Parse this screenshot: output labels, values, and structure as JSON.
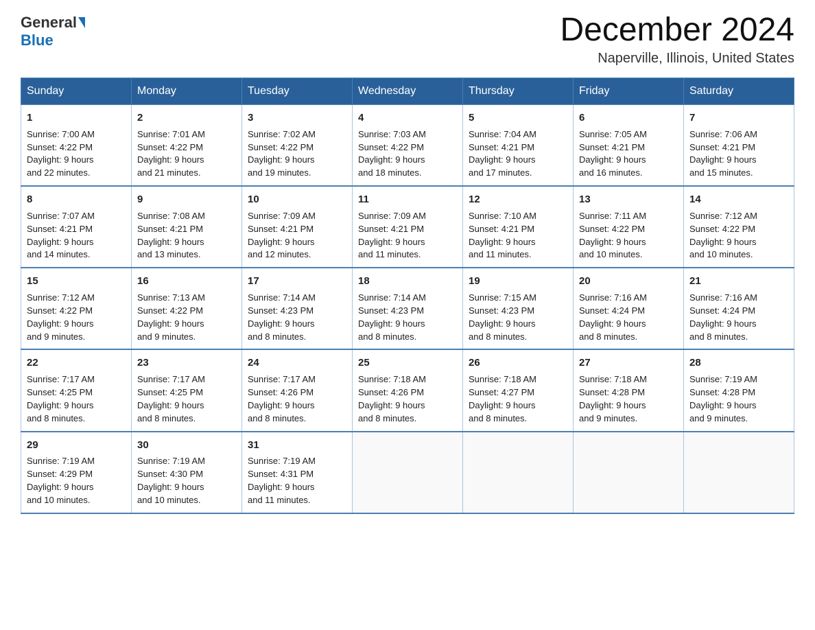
{
  "logo": {
    "text_general": "General",
    "text_blue": "Blue"
  },
  "title": "December 2024",
  "location": "Naperville, Illinois, United States",
  "days_of_week": [
    "Sunday",
    "Monday",
    "Tuesday",
    "Wednesday",
    "Thursday",
    "Friday",
    "Saturday"
  ],
  "weeks": [
    [
      {
        "day": "1",
        "sunrise": "7:00 AM",
        "sunset": "4:22 PM",
        "daylight": "9 hours and 22 minutes."
      },
      {
        "day": "2",
        "sunrise": "7:01 AM",
        "sunset": "4:22 PM",
        "daylight": "9 hours and 21 minutes."
      },
      {
        "day": "3",
        "sunrise": "7:02 AM",
        "sunset": "4:22 PM",
        "daylight": "9 hours and 19 minutes."
      },
      {
        "day": "4",
        "sunrise": "7:03 AM",
        "sunset": "4:22 PM",
        "daylight": "9 hours and 18 minutes."
      },
      {
        "day": "5",
        "sunrise": "7:04 AM",
        "sunset": "4:21 PM",
        "daylight": "9 hours and 17 minutes."
      },
      {
        "day": "6",
        "sunrise": "7:05 AM",
        "sunset": "4:21 PM",
        "daylight": "9 hours and 16 minutes."
      },
      {
        "day": "7",
        "sunrise": "7:06 AM",
        "sunset": "4:21 PM",
        "daylight": "9 hours and 15 minutes."
      }
    ],
    [
      {
        "day": "8",
        "sunrise": "7:07 AM",
        "sunset": "4:21 PM",
        "daylight": "9 hours and 14 minutes."
      },
      {
        "day": "9",
        "sunrise": "7:08 AM",
        "sunset": "4:21 PM",
        "daylight": "9 hours and 13 minutes."
      },
      {
        "day": "10",
        "sunrise": "7:09 AM",
        "sunset": "4:21 PM",
        "daylight": "9 hours and 12 minutes."
      },
      {
        "day": "11",
        "sunrise": "7:09 AM",
        "sunset": "4:21 PM",
        "daylight": "9 hours and 11 minutes."
      },
      {
        "day": "12",
        "sunrise": "7:10 AM",
        "sunset": "4:21 PM",
        "daylight": "9 hours and 11 minutes."
      },
      {
        "day": "13",
        "sunrise": "7:11 AM",
        "sunset": "4:22 PM",
        "daylight": "9 hours and 10 minutes."
      },
      {
        "day": "14",
        "sunrise": "7:12 AM",
        "sunset": "4:22 PM",
        "daylight": "9 hours and 10 minutes."
      }
    ],
    [
      {
        "day": "15",
        "sunrise": "7:12 AM",
        "sunset": "4:22 PM",
        "daylight": "9 hours and 9 minutes."
      },
      {
        "day": "16",
        "sunrise": "7:13 AM",
        "sunset": "4:22 PM",
        "daylight": "9 hours and 9 minutes."
      },
      {
        "day": "17",
        "sunrise": "7:14 AM",
        "sunset": "4:23 PM",
        "daylight": "9 hours and 8 minutes."
      },
      {
        "day": "18",
        "sunrise": "7:14 AM",
        "sunset": "4:23 PM",
        "daylight": "9 hours and 8 minutes."
      },
      {
        "day": "19",
        "sunrise": "7:15 AM",
        "sunset": "4:23 PM",
        "daylight": "9 hours and 8 minutes."
      },
      {
        "day": "20",
        "sunrise": "7:16 AM",
        "sunset": "4:24 PM",
        "daylight": "9 hours and 8 minutes."
      },
      {
        "day": "21",
        "sunrise": "7:16 AM",
        "sunset": "4:24 PM",
        "daylight": "9 hours and 8 minutes."
      }
    ],
    [
      {
        "day": "22",
        "sunrise": "7:17 AM",
        "sunset": "4:25 PM",
        "daylight": "9 hours and 8 minutes."
      },
      {
        "day": "23",
        "sunrise": "7:17 AM",
        "sunset": "4:25 PM",
        "daylight": "9 hours and 8 minutes."
      },
      {
        "day": "24",
        "sunrise": "7:17 AM",
        "sunset": "4:26 PM",
        "daylight": "9 hours and 8 minutes."
      },
      {
        "day": "25",
        "sunrise": "7:18 AM",
        "sunset": "4:26 PM",
        "daylight": "9 hours and 8 minutes."
      },
      {
        "day": "26",
        "sunrise": "7:18 AM",
        "sunset": "4:27 PM",
        "daylight": "9 hours and 8 minutes."
      },
      {
        "day": "27",
        "sunrise": "7:18 AM",
        "sunset": "4:28 PM",
        "daylight": "9 hours and 9 minutes."
      },
      {
        "day": "28",
        "sunrise": "7:19 AM",
        "sunset": "4:28 PM",
        "daylight": "9 hours and 9 minutes."
      }
    ],
    [
      {
        "day": "29",
        "sunrise": "7:19 AM",
        "sunset": "4:29 PM",
        "daylight": "9 hours and 10 minutes."
      },
      {
        "day": "30",
        "sunrise": "7:19 AM",
        "sunset": "4:30 PM",
        "daylight": "9 hours and 10 minutes."
      },
      {
        "day": "31",
        "sunrise": "7:19 AM",
        "sunset": "4:31 PM",
        "daylight": "9 hours and 11 minutes."
      },
      null,
      null,
      null,
      null
    ]
  ],
  "labels": {
    "sunrise": "Sunrise:",
    "sunset": "Sunset:",
    "daylight": "Daylight:"
  }
}
